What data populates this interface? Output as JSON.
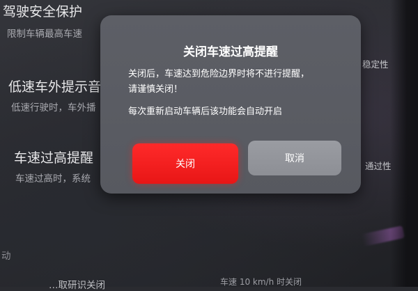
{
  "settings": [
    {
      "title": "驾驶安全保护",
      "desc": "限制车辆最高车速"
    },
    {
      "title": "低速车外提示音",
      "desc": "低速行驶时，车外播"
    },
    {
      "title": "车速过高提醒",
      "desc": "车速过高时，系统"
    }
  ],
  "side_labels": [
    "稳定性",
    "通过性"
  ],
  "bottom_fragments": {
    "left": "动",
    "bottom_text": "…取研识关闭",
    "bottom_right": "车速 10 km/h 时关闭"
  },
  "dialog": {
    "title": "关闭车速过高提醒",
    "message_line1": "关闭后，车速达到危险边界时将不进行提醒，",
    "message_line2": "请谨慎关闭！",
    "message_line3": "每次重新启动车辆后该功能会自动开启",
    "close_label": "关闭",
    "cancel_label": "取消"
  },
  "colors": {
    "close_button": "#f01e1e",
    "cancel_button": "#95979d",
    "dialog_bg": "#5b5d64"
  }
}
